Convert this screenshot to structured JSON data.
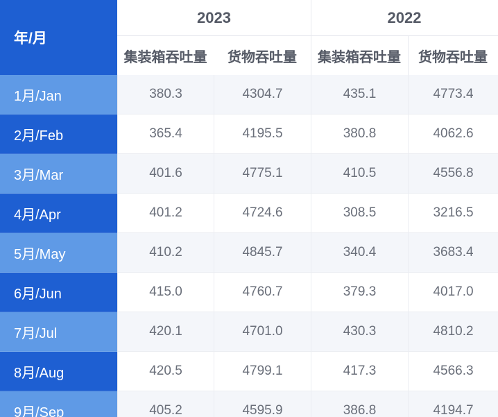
{
  "header": {
    "month_label": "年/月",
    "year_2023": "2023",
    "year_2022": "2022",
    "container_label": "集装箱吞吐量",
    "cargo_label": "货物吞吐量"
  },
  "rows": [
    {
      "month": "1月/Jan",
      "c2023": "380.3",
      "g2023": "4304.7",
      "c2022": "435.1",
      "g2022": "4773.4"
    },
    {
      "month": "2月/Feb",
      "c2023": "365.4",
      "g2023": "4195.5",
      "c2022": "380.8",
      "g2022": "4062.6"
    },
    {
      "month": "3月/Mar",
      "c2023": "401.6",
      "g2023": "4775.1",
      "c2022": "410.5",
      "g2022": "4556.8"
    },
    {
      "month": "4月/Apr",
      "c2023": "401.2",
      "g2023": "4724.6",
      "c2022": "308.5",
      "g2022": "3216.5"
    },
    {
      "month": "5月/May",
      "c2023": "410.2",
      "g2023": "4845.7",
      "c2022": "340.4",
      "g2022": "3683.4"
    },
    {
      "month": "6月/Jun",
      "c2023": "415.0",
      "g2023": "4760.7",
      "c2022": "379.3",
      "g2022": "4017.0"
    },
    {
      "month": "7月/Jul",
      "c2023": "420.1",
      "g2023": "4701.0",
      "c2022": "430.3",
      "g2022": "4810.2"
    },
    {
      "month": "8月/Aug",
      "c2023": "420.5",
      "g2023": "4799.1",
      "c2022": "417.3",
      "g2022": "4566.3"
    },
    {
      "month": "9月/Sep",
      "c2023": "405.2",
      "g2023": "4595.9",
      "c2022": "386.8",
      "g2022": "4194.7"
    }
  ],
  "colors": {
    "header_blue": "#1e5fd2",
    "row_light_blue": "#5f9ae6",
    "row_dark_blue": "#1e5fd2",
    "cell_alt_bg": "#f4f6fa",
    "text_gray": "#6a6f7a"
  }
}
